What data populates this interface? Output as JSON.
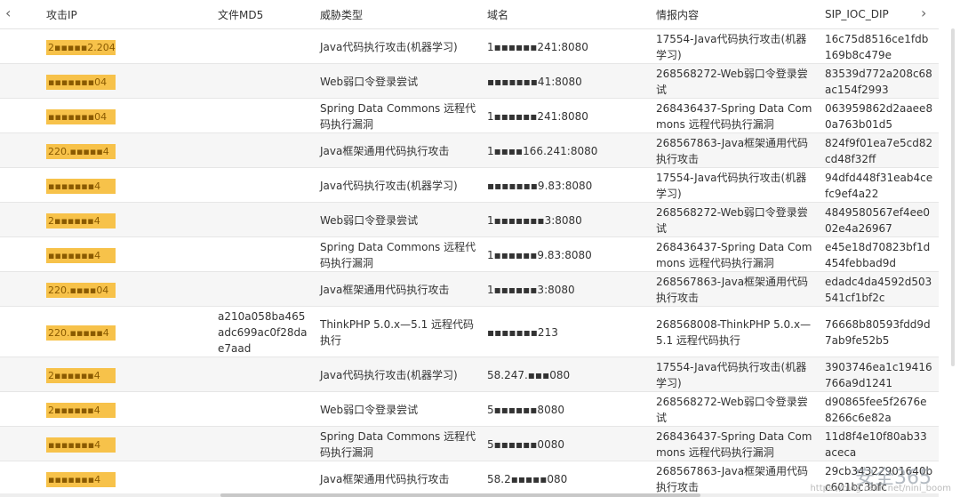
{
  "nav": {
    "prev_glyph": "‹",
    "next_glyph": "›"
  },
  "columns": [
    "攻击IP",
    "文件MD5",
    "威胁类型",
    "域名",
    "情报内容",
    "SIP_IOC_DIP"
  ],
  "rows": [
    {
      "ip": "2▪▪▪▪▪2.204",
      "md5": "",
      "type": "Java代码执行攻击(机器学习)",
      "domain": "1▪▪▪▪▪▪241:8080",
      "intel": "17554-Java代码执行攻击(机器学习)",
      "dip": "16c75d8516ce1fdb169b8c479e"
    },
    {
      "ip": "▪▪▪▪▪▪▪04",
      "md5": "",
      "type": "Web弱口令登录尝试",
      "domain": "▪▪▪▪▪▪▪41:8080",
      "intel": "268568272-Web弱口令登录尝试",
      "dip": "83539d772a208c68ac154f2993"
    },
    {
      "ip": "▪▪▪▪▪▪▪04",
      "md5": "",
      "type": "Spring Data Commons 远程代码执行漏洞",
      "domain": "1▪▪▪▪▪▪241:8080",
      "intel": "268436437-Spring Data Commons 远程代码执行漏洞",
      "dip": "063959862d2aaee80a763b01d5"
    },
    {
      "ip": "220.▪▪▪▪▪4",
      "md5": "",
      "type": "Java框架通用代码执行攻击",
      "domain": "1▪▪▪▪166.241:8080",
      "intel": "268567863-Java框架通用代码执行攻击",
      "dip": "824f9f01ea7e5cd82cd48f32ff"
    },
    {
      "ip": "▪▪▪▪▪▪▪4",
      "md5": "",
      "type": "Java代码执行攻击(机器学习)",
      "domain": "▪▪▪▪▪▪▪9.83:8080",
      "intel": "17554-Java代码执行攻击(机器学习)",
      "dip": "94dfd448f31eab4cefc9ef4a22"
    },
    {
      "ip": "2▪▪▪▪▪▪4",
      "md5": "",
      "type": "Web弱口令登录尝试",
      "domain": "1▪▪▪▪▪▪▪3:8080",
      "intel": "268568272-Web弱口令登录尝试",
      "dip": "4849580567ef4ee002e4a26967"
    },
    {
      "ip": "▪▪▪▪▪▪▪4",
      "md5": "",
      "type": "Spring Data Commons 远程代码执行漏洞",
      "domain": "1▪▪▪▪▪▪9.83:8080",
      "intel": "268436437-Spring Data Commons 远程代码执行漏洞",
      "dip": "e45e18d70823bf1d454febbad9d"
    },
    {
      "ip": "220.▪▪▪▪04",
      "md5": "",
      "type": "Java框架通用代码执行攻击",
      "domain": "1▪▪▪▪▪▪3:8080",
      "intel": "268567863-Java框架通用代码执行攻击",
      "dip": "edadc4da4592d503541cf1bf2c"
    },
    {
      "ip": "220.▪▪▪▪▪4",
      "md5": "a210a058ba465adc699ac0f28dae7aad",
      "type": "ThinkPHP 5.0.x—5.1 远程代码执行",
      "domain": "▪▪▪▪▪▪▪213",
      "intel": "268568008-ThinkPHP 5.0.x—5.1 远程代码执行",
      "dip": "76668b80593fdd9d7ab9fe52b5"
    },
    {
      "ip": "2▪▪▪▪▪▪4",
      "md5": "",
      "type": "Java代码执行攻击(机器学习)",
      "domain": "58.247.▪▪▪080",
      "intel": "17554-Java代码执行攻击(机器学习)",
      "dip": "3903746ea1c19416766a9d1241"
    },
    {
      "ip": "2▪▪▪▪▪▪4",
      "md5": "",
      "type": "Web弱口令登录尝试",
      "domain": "5▪▪▪▪▪▪8080",
      "intel": "268568272-Web弱口令登录尝试",
      "dip": "d90865fee5f2676e8266c6e82a"
    },
    {
      "ip": "▪▪▪▪▪▪▪4",
      "md5": "",
      "type": "Spring Data Commons 远程代码执行漏洞",
      "domain": "5▪▪▪▪▪▪0080",
      "intel": "268436437-Spring Data Commons 远程代码执行漏洞",
      "dip": "11d8f4e10f80ab33aceca"
    },
    {
      "ip": "▪▪▪▪▪▪▪4",
      "md5": "",
      "type": "Java框架通用代码执行攻击",
      "domain": "58.2▪▪▪▪▪080",
      "intel": "268567863-Java框架通用代码执行攻击",
      "dip": "29cb34322901640bc601bc3bfc"
    }
  ],
  "mask_color": "#f7c24a",
  "watermark": "安全365",
  "url_watermark": "https://blog.csdn.net/nini_boom"
}
